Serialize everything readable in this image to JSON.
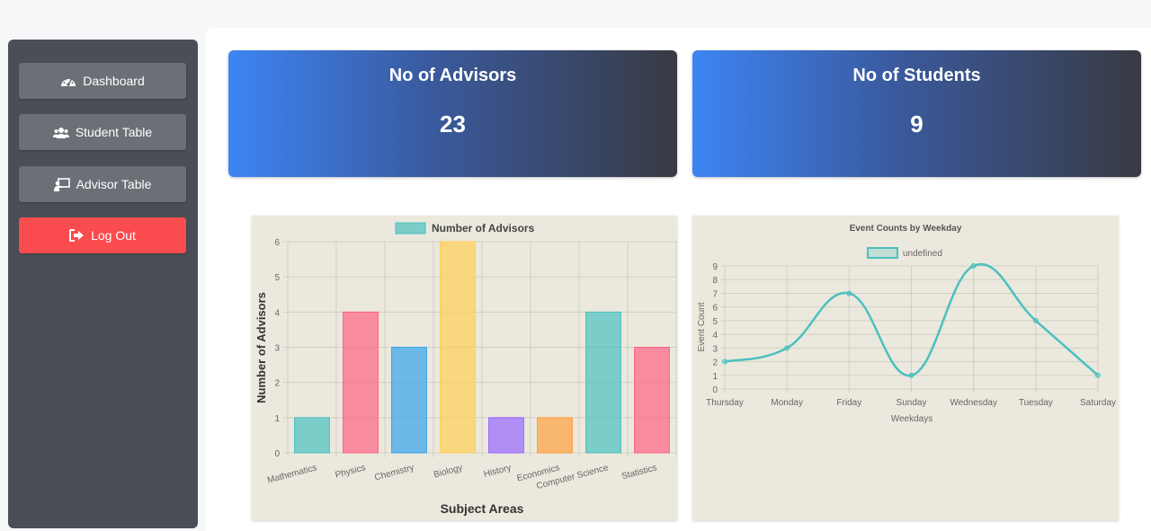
{
  "sidebar": {
    "items": [
      {
        "label": "Dashboard",
        "icon": "gauge-icon"
      },
      {
        "label": "Student Table",
        "icon": "users-icon"
      },
      {
        "label": "Advisor Table",
        "icon": "chalkboard-teacher-icon"
      }
    ],
    "logout": {
      "label": "Log Out",
      "icon": "sign-out-icon"
    }
  },
  "stats": {
    "advisors": {
      "title": "No of Advisors",
      "value": "23"
    },
    "students": {
      "title": "No of Students",
      "value": "9"
    }
  },
  "colors": {
    "accent": "#3d85f2",
    "logout": "#fa4b4e",
    "sidebar": "#4a4f56",
    "chart_bg": "#ebe9dd",
    "teal": "#4bc0c0"
  },
  "chart_data": [
    {
      "type": "bar",
      "categories": [
        "Mathematics",
        "Physics",
        "Chemistry",
        "Biology",
        "History",
        "Economics",
        "Computer Science",
        "Statistics"
      ],
      "series": [
        {
          "name": "Number of Advisors",
          "values": [
            1,
            4,
            3,
            6,
            1,
            1,
            4,
            3
          ]
        }
      ],
      "bar_colors": [
        "#4bc0c0",
        "#ff6384",
        "#36a2eb",
        "#ffce56",
        "#9966ff",
        "#ff9f40",
        "#4bc0c0",
        "#ff6384"
      ],
      "xlabel": "Subject Areas",
      "ylabel": "Number of Advisors",
      "ylim": [
        0,
        6
      ],
      "yticks": [
        0,
        1,
        2,
        3,
        4,
        5,
        6
      ],
      "legend": "top",
      "grid": true
    },
    {
      "type": "line",
      "title": "Event Counts by Weekday",
      "x": [
        "Thursday",
        "Monday",
        "Friday",
        "Sunday",
        "Wednesday",
        "Tuesday",
        "Saturday"
      ],
      "series": [
        {
          "name": "undefined",
          "values": [
            2,
            3,
            7,
            1,
            9,
            5,
            1
          ]
        }
      ],
      "xlabel": "Weekdays",
      "ylabel": "Event Count",
      "ylim": [
        0,
        9
      ],
      "yticks": [
        0,
        1,
        2,
        3,
        4,
        5,
        6,
        7,
        8,
        9
      ],
      "legend": "top",
      "grid": true
    }
  ]
}
